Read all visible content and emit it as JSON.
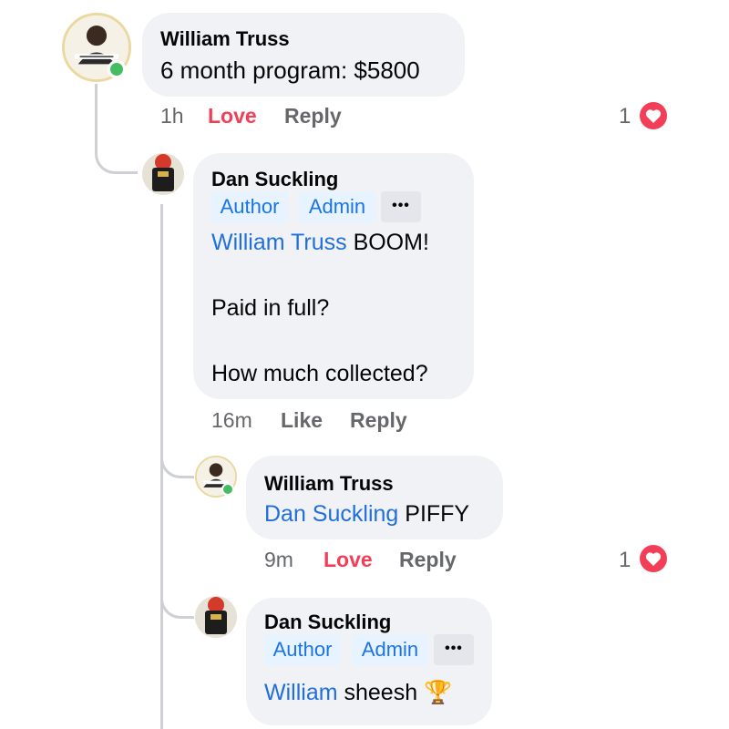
{
  "comments": [
    {
      "author": "William Truss",
      "text": "6 month program: $5800",
      "time": "1h",
      "reaction_label": "Love",
      "reply_label": "Reply",
      "reaction_count": "1"
    },
    {
      "author": "Dan Suckling",
      "badges": [
        "Author",
        "Admin"
      ],
      "more_label": "•••",
      "mention": "William Truss",
      "lines": [
        "BOOM!",
        "Paid in full?",
        "How much collected?"
      ],
      "time": "16m",
      "reaction_label": "Like",
      "reply_label": "Reply"
    },
    {
      "author": "William Truss",
      "mention": "Dan Suckling",
      "text": "PIFFY",
      "time": "9m",
      "reaction_label": "Love",
      "reply_label": "Reply",
      "reaction_count": "1"
    },
    {
      "author": "Dan Suckling",
      "badges": [
        "Author",
        "Admin"
      ],
      "more_label": "•••",
      "mention": "William",
      "text": "sheesh",
      "emoji": "🏆"
    }
  ],
  "colors": {
    "bubble": "#f0f2f5",
    "mention": "#216fdb",
    "love": "#f33e58",
    "meta": "#65676b",
    "badge_bg": "#e7f3ff",
    "online": "#45bd62"
  },
  "icons": {
    "reaction": "heart-icon",
    "more": "more-options-icon",
    "online": "online-status-icon",
    "trophy": "trophy-emoji"
  }
}
